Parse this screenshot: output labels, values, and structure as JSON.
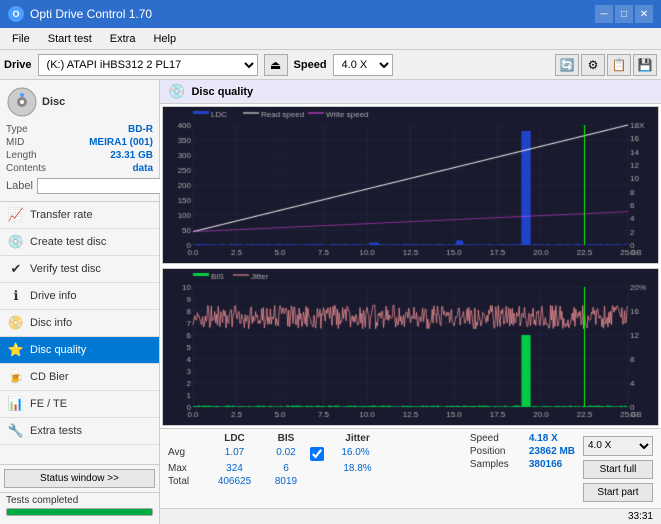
{
  "window": {
    "title": "Opti Drive Control 1.70",
    "icon": "O"
  },
  "titlebar": {
    "minimize": "─",
    "maximize": "□",
    "close": "✕"
  },
  "menu": {
    "items": [
      "File",
      "Start test",
      "Extra",
      "Help"
    ]
  },
  "drivebar": {
    "drive_label": "Drive",
    "drive_value": "(K:)  ATAPI iHBS312  2 PL17",
    "speed_label": "Speed",
    "speed_value": "4.0 X"
  },
  "disc": {
    "type_label": "Type",
    "type_value": "BD-R",
    "mid_label": "MID",
    "mid_value": "MEIRA1 (001)",
    "length_label": "Length",
    "length_value": "23.31 GB",
    "contents_label": "Contents",
    "contents_value": "data",
    "label_label": "Label"
  },
  "nav": {
    "items": [
      {
        "id": "transfer-rate",
        "label": "Transfer rate",
        "icon": "📈"
      },
      {
        "id": "create-test-disc",
        "label": "Create test disc",
        "icon": "💿"
      },
      {
        "id": "verify-test-disc",
        "label": "Verify test disc",
        "icon": "✔"
      },
      {
        "id": "drive-info",
        "label": "Drive info",
        "icon": "ℹ"
      },
      {
        "id": "disc-info",
        "label": "Disc info",
        "icon": "📀"
      },
      {
        "id": "disc-quality",
        "label": "Disc quality",
        "icon": "⭐",
        "active": true
      },
      {
        "id": "cd-bier",
        "label": "CD Bier",
        "icon": "🍺"
      },
      {
        "id": "fe-te",
        "label": "FE / TE",
        "icon": "📊"
      },
      {
        "id": "extra-tests",
        "label": "Extra tests",
        "icon": "🔧"
      }
    ]
  },
  "disc_quality": {
    "title": "Disc quality",
    "legend": {
      "ldc": "LDC",
      "read_speed": "Read speed",
      "write_speed": "Write speed",
      "bis": "BIS",
      "jitter": "Jitter"
    },
    "chart1": {
      "y_max": 400,
      "y_right_max": 18,
      "x_max": 25,
      "y_label_right": "X"
    },
    "chart2": {
      "y_max": 10,
      "y_right_max": 20,
      "x_max": 25,
      "y_label_right": "%"
    }
  },
  "stats": {
    "headers": [
      "",
      "LDC",
      "BIS",
      "",
      "Jitter",
      "Speed",
      ""
    ],
    "avg_label": "Avg",
    "max_label": "Max",
    "total_label": "Total",
    "ldc_avg": "1.07",
    "ldc_max": "324",
    "ldc_total": "406625",
    "bis_avg": "0.02",
    "bis_max": "6",
    "bis_total": "8019",
    "jitter_avg": "16.0%",
    "jitter_max": "18.8%",
    "jitter_total": "",
    "speed_label": "Speed",
    "speed_value": "4.18 X",
    "position_label": "Position",
    "position_value": "23862 MB",
    "samples_label": "Samples",
    "samples_value": "380166",
    "speed_select": "4.0 X",
    "btn_start_full": "Start full",
    "btn_start_part": "Start part"
  },
  "statusbar": {
    "text": "Tests completed",
    "progress": 100,
    "time": "33:31"
  }
}
